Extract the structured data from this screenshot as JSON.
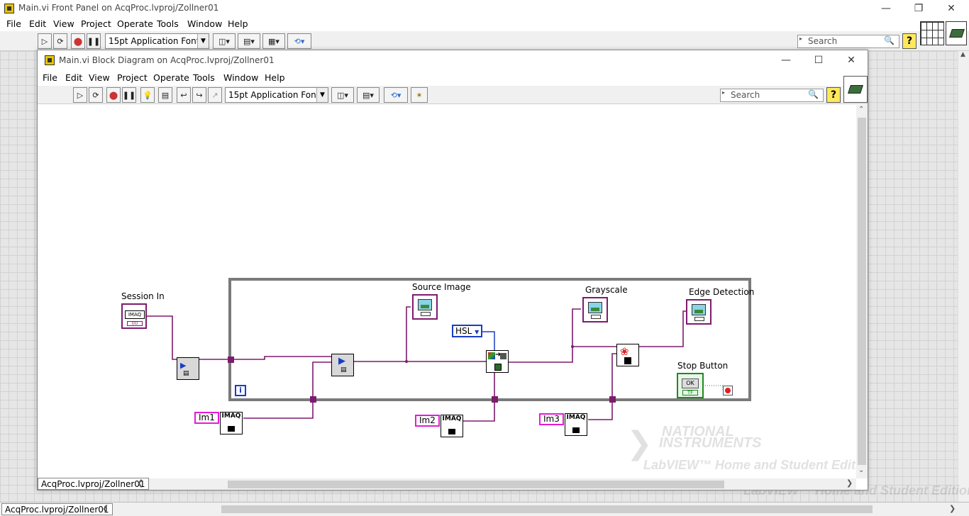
{
  "front_panel": {
    "title": "Main.vi Front Panel on AcqProc.lvproj/Zollner01",
    "menu": [
      "File",
      "Edit",
      "View",
      "Project",
      "Operate",
      "Tools",
      "Window",
      "Help"
    ],
    "font_selector": "15pt Application Font",
    "search_placeholder": "Search",
    "help_glyph": "?",
    "status_path": "AcqProc.lvproj/Zollner01"
  },
  "block_diagram": {
    "title": "Main.vi Block Diagram on AcqProc.lvproj/Zollner01",
    "menu": [
      "File",
      "Edit",
      "View",
      "Project",
      "Operate",
      "Tools",
      "Window",
      "Help"
    ],
    "font_selector": "15pt Application Font",
    "search_placeholder": "Search",
    "help_glyph": "?",
    "status_path": "AcqProc.lvproj/Zollner01",
    "labels": {
      "session_in": "Session In",
      "source_image": "Source Image",
      "grayscale": "Grayscale",
      "edge_detection": "Edge Detection",
      "stop_button": "Stop Button"
    },
    "constants": {
      "hsl": "HSL",
      "im1": "Im1",
      "im2": "Im2",
      "im3": "Im3"
    },
    "node_text": {
      "imaq": "IMAQ",
      "iteration": "i",
      "ok": "OK",
      "tf": "TF",
      "io": "I/O"
    }
  },
  "watermark": {
    "brand_line1": "NATIONAL",
    "brand_line2": "INSTRUMENTS",
    "edition": "LabVIEW™ Home and Student Edition",
    "edition_plain": "LabVIEW™ Home and Student Edition"
  },
  "colors": {
    "image_wire": "#7d1b6e",
    "enum_wire": "#1a3dc6",
    "bool_wire": "#1f8a1f",
    "image_const_border": "#e41bd7",
    "loop_frame": "#7a7a7a"
  }
}
